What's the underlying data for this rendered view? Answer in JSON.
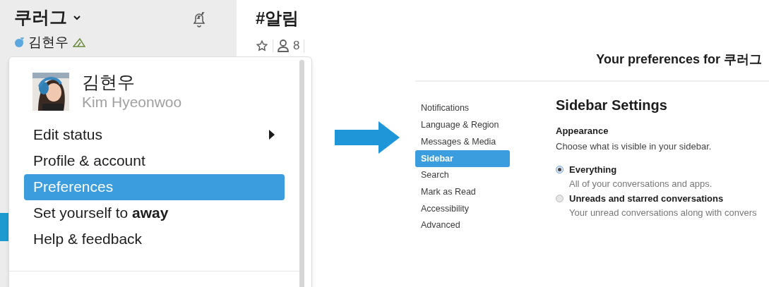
{
  "workspace": {
    "name": "쿠러그",
    "user": "김현우"
  },
  "channel": {
    "name": "#알림",
    "members": "8"
  },
  "menu": {
    "name": "김현우",
    "romanized": "Kim Hyeonwoo",
    "items": [
      {
        "label": "Edit status",
        "submenu": true,
        "selected": false
      },
      {
        "label": "Profile & account",
        "submenu": false,
        "selected": false
      },
      {
        "label": "Preferences",
        "submenu": false,
        "selected": true
      },
      {
        "label": "Set yourself to **away**",
        "submenu": false,
        "selected": false
      },
      {
        "label": "Help & feedback",
        "submenu": false,
        "selected": false
      }
    ]
  },
  "preferences": {
    "title": "Your preferences for 쿠러그",
    "nav": [
      {
        "label": "Notifications",
        "selected": false
      },
      {
        "label": "Language & Region",
        "selected": false
      },
      {
        "label": "Messages & Media",
        "selected": false
      },
      {
        "label": "Sidebar",
        "selected": true
      },
      {
        "label": "Search",
        "selected": false
      },
      {
        "label": "Mark as Read",
        "selected": false
      },
      {
        "label": "Accessibility",
        "selected": false
      },
      {
        "label": "Advanced",
        "selected": false
      }
    ],
    "section_title": "Sidebar Settings",
    "group_title": "Appearance",
    "group_description": "Choose what is visible in your sidebar.",
    "options": [
      {
        "label": "Everything",
        "description": "All of your conversations and apps.",
        "selected": true
      },
      {
        "label": "Unreads and starred conversations",
        "description": "Your unread conversations along with convers",
        "selected": false
      }
    ]
  }
}
